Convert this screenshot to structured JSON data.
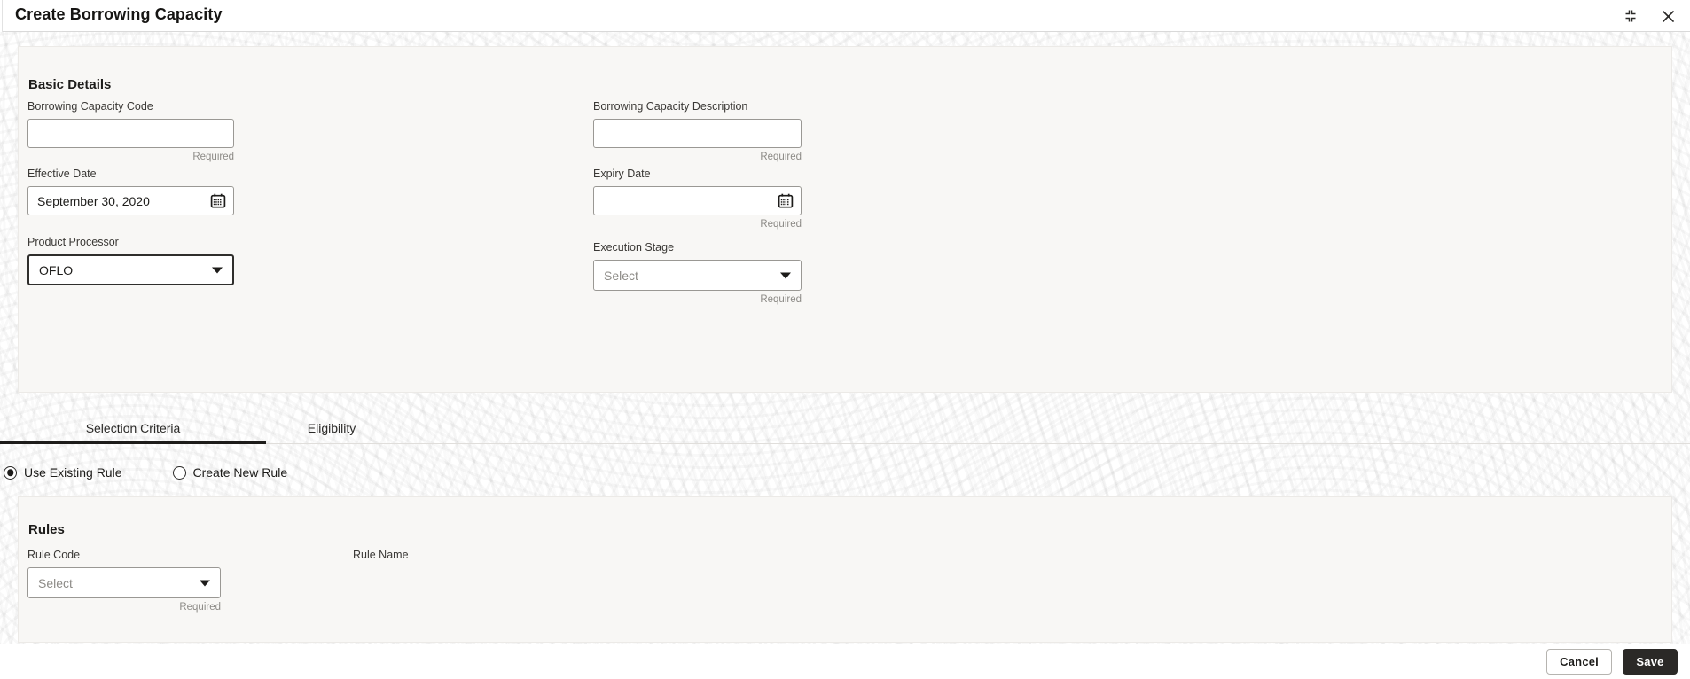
{
  "window": {
    "title": "Create Borrowing Capacity",
    "actions": [
      {
        "name": "collapse-icon",
        "label": "Collapse"
      },
      {
        "name": "close-icon",
        "label": "Close"
      }
    ]
  },
  "basic_details": {
    "heading": "Basic Details",
    "fields": {
      "borrowing_capacity_code": {
        "label": "Borrowing Capacity Code",
        "value": "",
        "placeholder": "",
        "hint": "Required"
      },
      "borrowing_capacity_description": {
        "label": "Borrowing Capacity Description",
        "value": "",
        "placeholder": "",
        "hint": "Required"
      },
      "effective_date": {
        "label": "Effective Date",
        "value": "September 30, 2020",
        "placeholder": "",
        "hint": "",
        "icon": "calendar-icon"
      },
      "expiry_date": {
        "label": "Expiry Date",
        "value": "",
        "placeholder": "",
        "hint": "Required",
        "icon": "calendar-icon"
      },
      "product_processor": {
        "label": "Product Processor",
        "value": "OFLO",
        "hint": "",
        "focused": true
      },
      "execution_stage": {
        "label": "Execution Stage",
        "value": "Select",
        "is_placeholder": true,
        "hint": "Required"
      }
    }
  },
  "tabs": [
    {
      "label": "Selection Criteria",
      "active": true
    },
    {
      "label": "Eligibility",
      "active": false
    }
  ],
  "rule_source": {
    "options": [
      {
        "label": "Use Existing Rule",
        "selected": true
      },
      {
        "label": "Create New Rule",
        "selected": false
      }
    ]
  },
  "rules": {
    "heading": "Rules",
    "rule_code": {
      "label": "Rule Code",
      "value": "Select",
      "is_placeholder": true,
      "hint": "Required"
    },
    "rule_name": {
      "label": "Rule Name",
      "value": ""
    }
  },
  "footer": {
    "cancel_label": "Cancel",
    "save_label": "Save"
  },
  "colors": {
    "panel_bg": "#f8f7f5",
    "page_bg": "#ffffff",
    "text_primary": "#1d1c1a",
    "text_muted": "#8d8b87",
    "primary_button": "#2b2927",
    "border": "#9a9894"
  }
}
